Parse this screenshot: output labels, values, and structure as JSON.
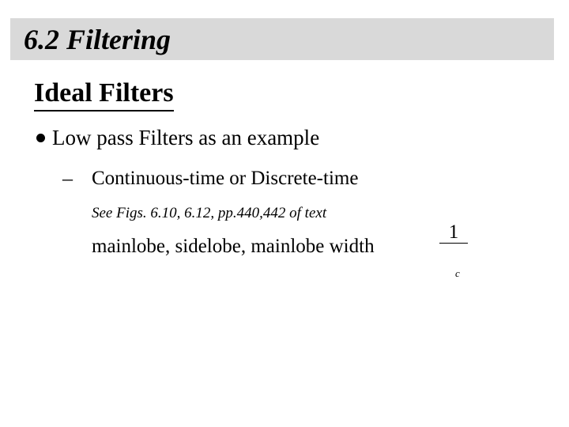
{
  "slide": {
    "title": "6.2 Filtering",
    "subtitle": "Ideal Filters",
    "bullet": "Low pass Filters as an example",
    "sub_bullet": "Continuous-time or Discrete-time",
    "dash_symbol": "–",
    "reference": "See Figs. 6.10, 6.12, pp.440,442 of text",
    "lobe_line": "mainlobe, sidelobe, mainlobe width",
    "fraction": {
      "numerator": "1",
      "subscript": "c"
    },
    "colors": {
      "title_bar": "#d9d9d9",
      "text": "#000000",
      "background": "#ffffff"
    }
  }
}
